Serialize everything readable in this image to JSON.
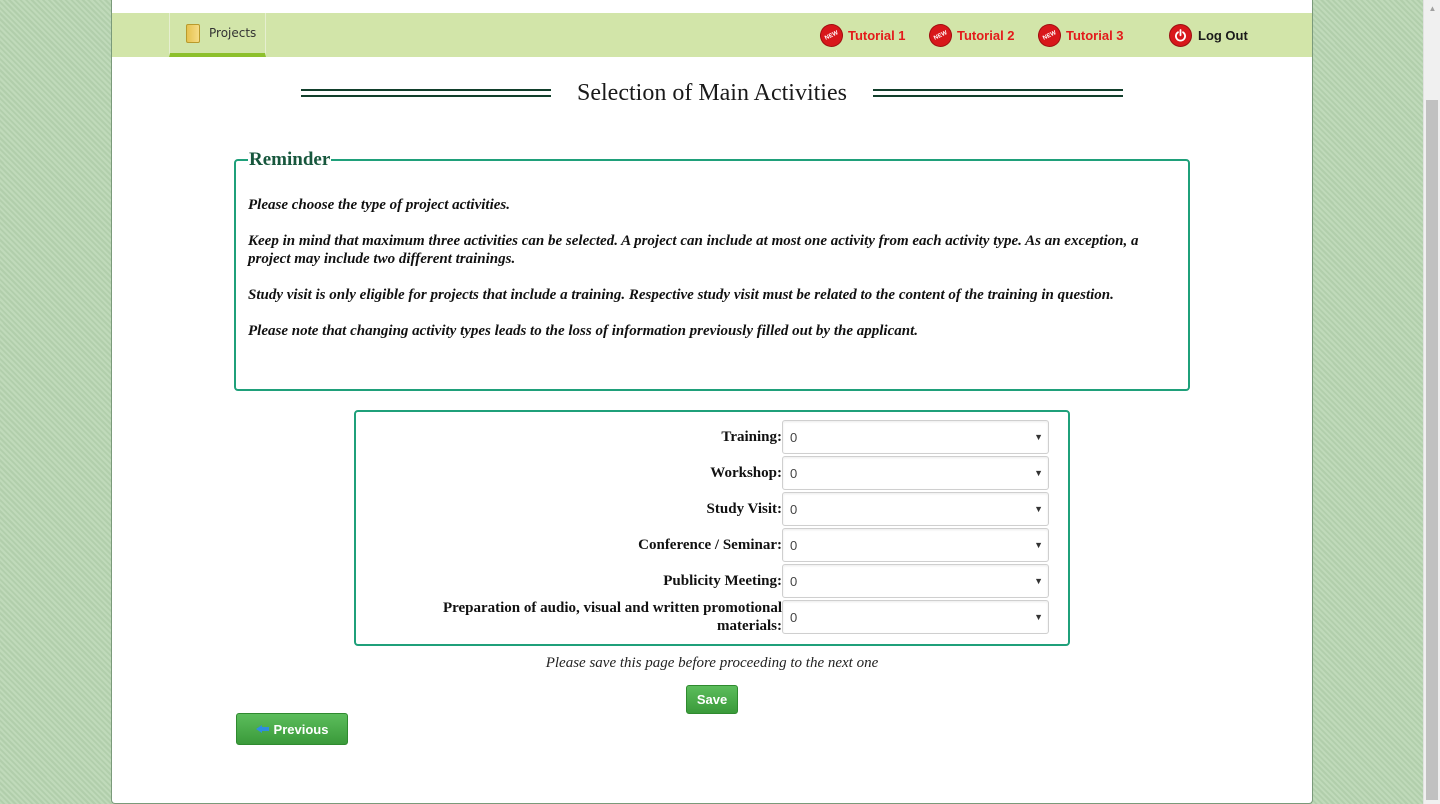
{
  "nav": {
    "projects_label": "Projects",
    "tutorials": [
      "Tutorial 1",
      "Tutorial 2",
      "Tutorial 3"
    ],
    "new_badge": "NEW",
    "logout_label": "Log Out"
  },
  "page_title": "Selection of Main Activities",
  "reminder": {
    "legend": "Reminder",
    "paragraphs": [
      "Please choose the type of project activities.",
      "Keep in mind that maximum three activities can be selected. A project can include at most one activity from each activity type. As an exception, a project may include two different trainings.",
      "Study visit is only eligible for projects that include a training. Respective study visit must be related to the content of the training in question.",
      "Please note that changing activity types leads to the loss of information previously filled out by the applicant."
    ]
  },
  "form": {
    "rows": [
      {
        "label": "Training:",
        "value": "0"
      },
      {
        "label": "Workshop:",
        "value": "0"
      },
      {
        "label": "Study Visit:",
        "value": "0"
      },
      {
        "label": "Conference / Seminar:",
        "value": "0"
      },
      {
        "label": "Publicity Meeting:",
        "value": "0"
      },
      {
        "label": "Preparation of audio, visual and written promotional materials:",
        "value": "0"
      }
    ]
  },
  "save_note": "Please save this page before proceeding to the next one",
  "buttons": {
    "save": "Save",
    "previous": "Previous"
  },
  "colors": {
    "accent_green": "#1fa07a",
    "nav_bg": "#d2e5a9",
    "tutorial_red": "#e31b1b",
    "button_green": "#4cae4c"
  }
}
